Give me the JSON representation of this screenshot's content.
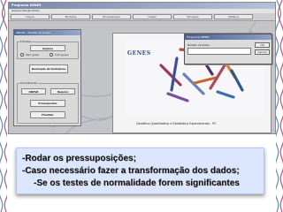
{
  "window": {
    "title": "Programa GENES",
    "menu": "Arquivo  Edição  Exibir"
  },
  "toolbar": [
    "Arquivo",
    "Biometria",
    "Processamento",
    "Análise",
    "Simulação",
    "Utilitários"
  ],
  "side_panel": {
    "title": "ANOVA - Modelo de Grupo",
    "group_entrada": "Entradas",
    "group_proc": "Procedimento",
    "btn_arquivo": "Arquivo",
    "opt_sem_grupo": "Sem grupo",
    "opt_com_grupo": "Com grupo",
    "btn_declaracao": "Declaração de Parâmetros",
    "btn_anova": "ANOVA",
    "btn_resumo": "Resumo",
    "btn_pressupostos": "Pressupostos",
    "btn_finalizar": "Finalizar"
  },
  "dialog": {
    "title": "Programa GENES",
    "label": "Número de dados",
    "ok": "OK",
    "cancel": "Cancel"
  },
  "main_panel": {
    "logo": "GENES",
    "caption": "Genética Quantitativa e Estatística Experimental - PC"
  },
  "slide": {
    "bullet1": "-Rodar os pressuposições;",
    "bullet2": "-Caso necessário fazer  a transformação dos dados;",
    "bullet3": "-Se os testes de normalidade forem significantes"
  },
  "colors": {
    "callout_bg": "#dde6ff",
    "titlebar": "#7a86aa",
    "window_bg": "#c8c8c8"
  }
}
